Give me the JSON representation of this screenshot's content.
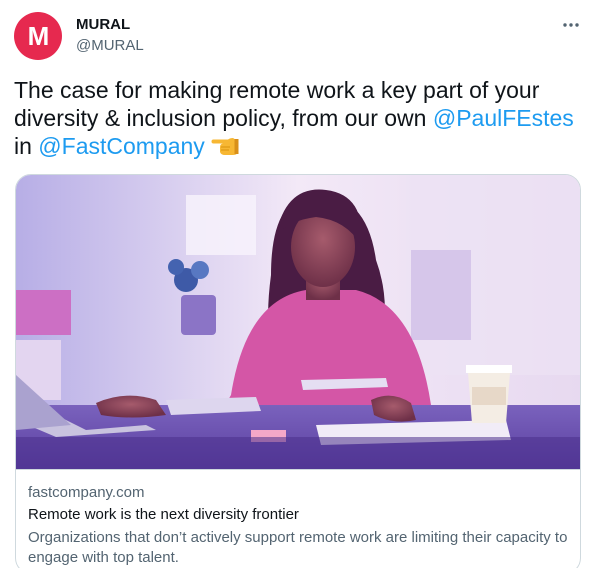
{
  "user": {
    "avatar_letter": "M",
    "avatar_color": "#e6294f",
    "name": "MURAL",
    "handle": "@MURAL"
  },
  "more_icon": "more-horizontal-icon",
  "tweet": {
    "text_before": "The case for making remote work a key part of your diversity & inclusion policy, from our own ",
    "mention_1": "@PaulFEstes",
    "text_middle": " in ",
    "mention_2": "@FastCompany",
    "emoji": "pointing-left-hand-icon",
    "link_color": "#1d9bf0"
  },
  "card": {
    "image_icon": "woman-working-at-desk-photo",
    "domain": "fastcompany.com",
    "title": "Remote work is the next diversity frontier",
    "description": "Organizations that don’t actively support remote work are limiting their capacity to engage with top talent."
  }
}
